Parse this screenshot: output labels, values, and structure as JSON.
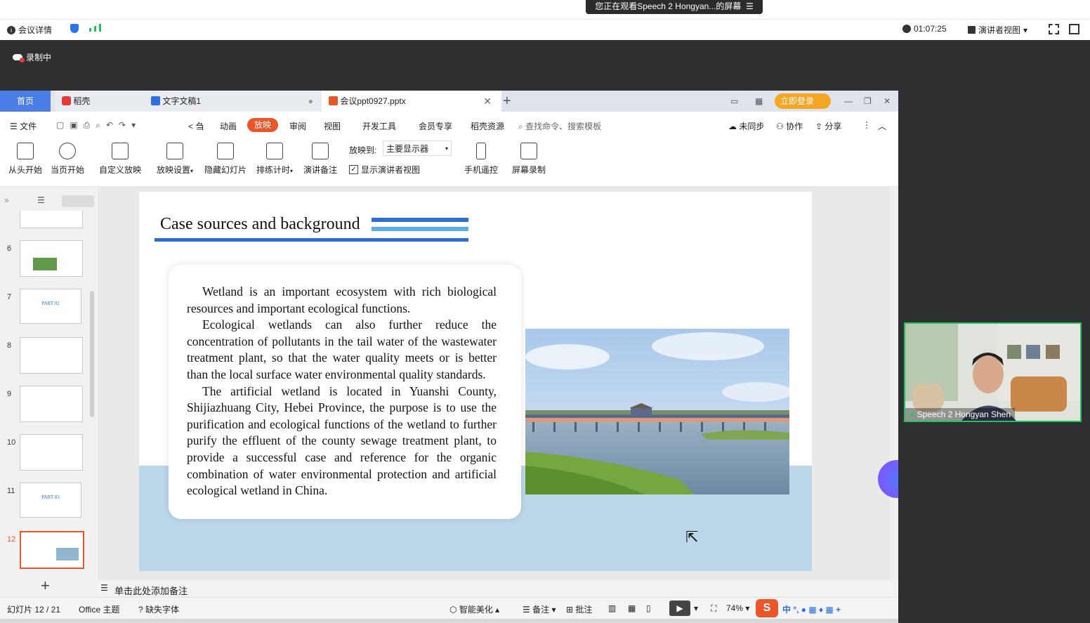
{
  "meeting": {
    "banner": "您正在观看Speech 2 Hongyan...的屏幕",
    "details": "会议详情",
    "timer": "01:07:25",
    "view_mode": "演讲者视图",
    "recording": "录制中",
    "participant": "Speech 2 Hongyan Shen"
  },
  "wps": {
    "tabs": {
      "home": "首页",
      "docer": "稻壳",
      "doc": "文字文稿1",
      "ppt": "会议ppt0927.pptx"
    },
    "login": "立即登录",
    "menu": {
      "file": "文件",
      "cut": "< 刍",
      "anim": "动画",
      "show": "放映",
      "review": "审阅",
      "view": "视图",
      "dev": "开发工具",
      "member": "会员专享",
      "res": "稻壳资源",
      "search": "查找命令、搜索模板",
      "unsync": "未同步",
      "collab": "协作",
      "share": "分享"
    },
    "ribbon": {
      "from_start": "从头开始",
      "from_current": "当页开始",
      "custom": "自定义放映",
      "settings": "放映设置",
      "hide": "隐藏幻灯片",
      "rehearse": "排练计时",
      "notes": "演讲备注",
      "show_to_label": "放映到:",
      "show_to_value": "主要显示器",
      "presenter_view": "显示演讲者视图",
      "remote": "手机遥控",
      "record": "屏幕录制"
    },
    "thumbs": [
      {
        "num": "6",
        "text": ""
      },
      {
        "num": "7",
        "text": "PART 02"
      },
      {
        "num": "8",
        "text": ""
      },
      {
        "num": "9",
        "text": ""
      },
      {
        "num": "10",
        "text": ""
      },
      {
        "num": "11",
        "text": "PART 03"
      },
      {
        "num": "12",
        "text": ""
      }
    ],
    "notes_placeholder": "单击此处添加备注",
    "status": {
      "slide": "幻灯片 12 / 21",
      "theme": "Office 主题",
      "missing_font": "缺失字体",
      "beautify": "智能美化",
      "notes": "备注",
      "comment": "批注",
      "zoom": "74%"
    }
  },
  "slide": {
    "title": "Case sources and background",
    "paragraphs": [
      "Wetland is an important ecosystem with rich biological resources and important ecological functions.",
      "Ecological wetlands can also further reduce the concentration of pollutants in the tail water of the wastewater treatment plant, so that the water quality meets or is better than the local surface water environmental quality standards.",
      "The artificial wetland is located in Yuanshi County, Shijiazhuang City, Hebei Province, the purpose is to use the purification and ecological functions of the wetland to further purify the effluent of the county sewage treatment plant, to provide a successful case and reference for the organic combination of water environmental protection and artificial ecological wetland in China."
    ]
  },
  "colors": {
    "accent": "#e8562a",
    "slide_blue": "#2f6fd1",
    "band": "#bcd7ea",
    "active_green": "#21c45a"
  }
}
